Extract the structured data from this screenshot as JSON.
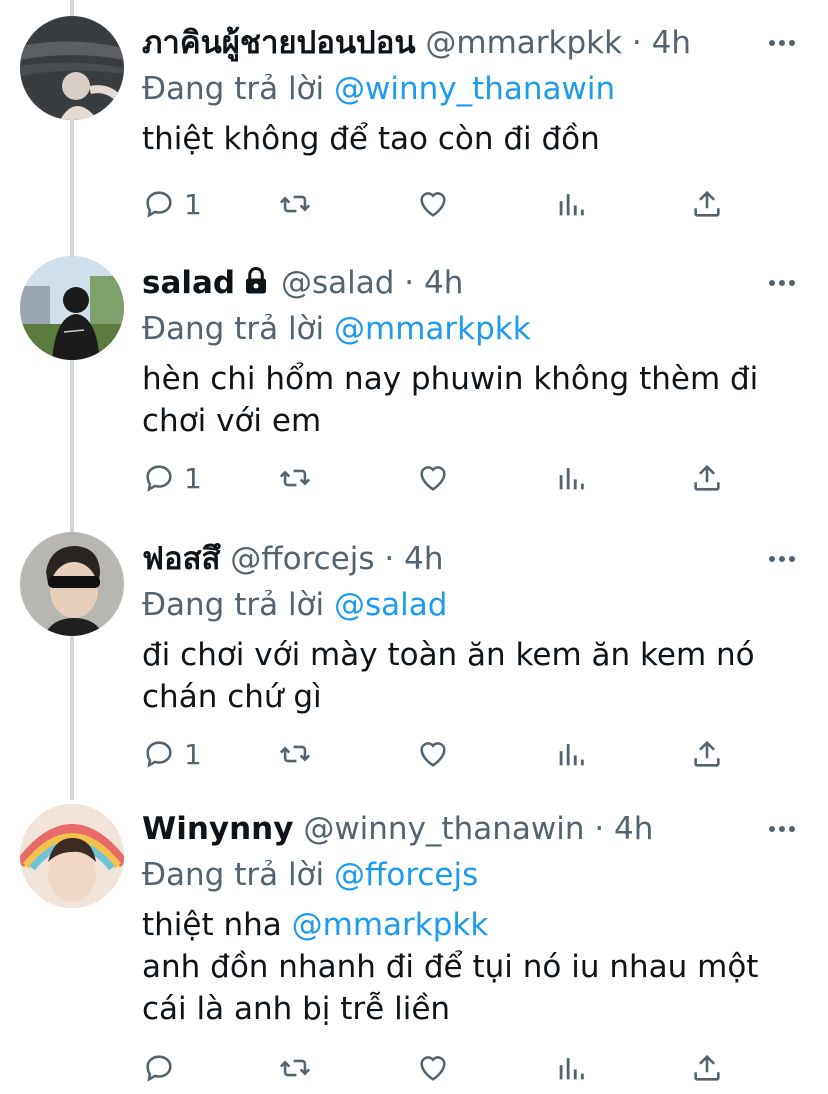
{
  "colors": {
    "accent": "#1d9bf0",
    "secondary_text": "#536471",
    "primary_text": "#0f1419",
    "thread_line": "#cfd9de"
  },
  "tweets": [
    {
      "name": "ภาคินผู้ชายปอนปอน",
      "handle": "@mmarkpkk",
      "time": "· 4h",
      "protected": false,
      "replying_label": "Đang trả lời",
      "replying_to": "@winny_thanawin",
      "lines": [
        "thiệt không để tao còn đi đồn"
      ],
      "reply_count": "1",
      "icons": [
        "reply-icon",
        "retweet-icon",
        "like-icon",
        "analytics-icon",
        "share-icon",
        "more-icon"
      ]
    },
    {
      "name": "salad",
      "handle": "@salad",
      "time": "· 4h",
      "protected": true,
      "replying_label": "Đang trả lời",
      "replying_to": "@mmarkpkk",
      "lines": [
        "hèn chi hổm nay phuwin không thèm đi",
        "chơi với em"
      ],
      "reply_count": "1"
    },
    {
      "name": "ฟอสสึ",
      "handle": "@fforcejs",
      "time": "· 4h",
      "protected": false,
      "replying_label": "Đang trả lời",
      "replying_to": "@salad",
      "lines": [
        "đi chơi với mày toàn ăn kem ăn kem nó",
        "chán chứ gì"
      ],
      "reply_count": "1"
    },
    {
      "name": "Winynny",
      "handle": "@winny_thanawin",
      "time": "· 4h",
      "protected": false,
      "replying_label": "Đang trả lời",
      "replying_to": "@fforcejs",
      "line1_prefix": "thiệt nha ",
      "line1_mention": "@mmarkpkk",
      "lines": [
        "anh đồn nhanh đi để tụi nó iu nhau một",
        "cái là anh bị trễ liền"
      ],
      "reply_count": ""
    }
  ]
}
